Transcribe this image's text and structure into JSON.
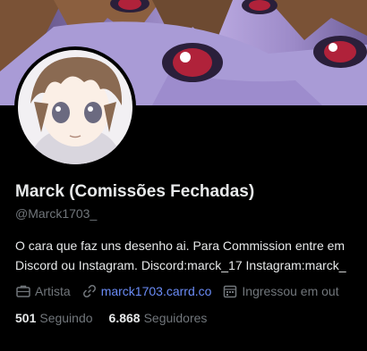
{
  "profile": {
    "display_name": "Marck (Comissões Fechadas)",
    "handle": "@Marck1703_",
    "bio_lines": [
      "O cara que faz uns desenho ai. Para Commission entre em",
      "Discord ou Instagram. Discord:marck_17 Instagram:marck_"
    ],
    "category": "Artista",
    "website": "marck1703.carrd.co",
    "joined": "Ingressou em out"
  },
  "stats": {
    "following_count": "501",
    "following_label": "Seguindo",
    "followers_count": "6.868",
    "followers_label": "Seguidores"
  },
  "colors": {
    "background": "#000000",
    "text_primary": "#e7e9ea",
    "text_secondary": "#71767b",
    "link": "#6b8cf7"
  },
  "icons": {
    "category": "briefcase-icon",
    "website": "link-icon",
    "joined": "calendar-icon"
  }
}
